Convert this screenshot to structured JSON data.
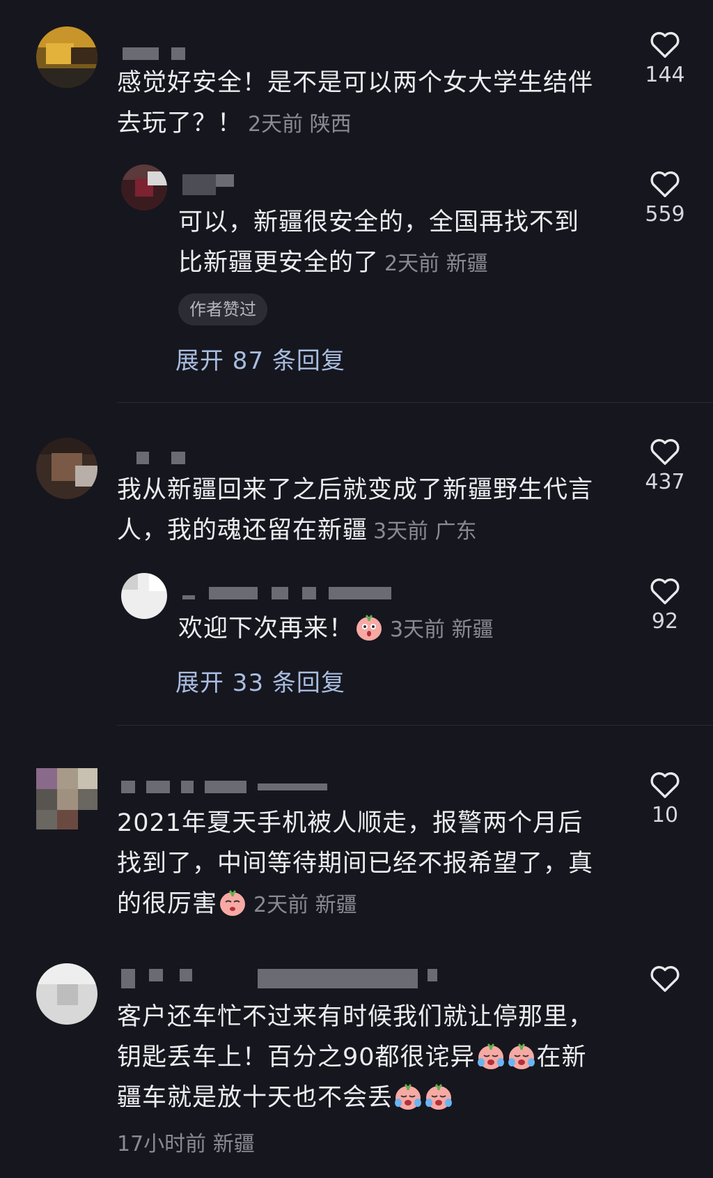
{
  "comments": [
    {
      "text": "感觉好安全！是不是可以两个女大学生结伴去玩了？！",
      "line1": "感觉好安全！是不是可以两个女大学生结伴",
      "line2": "去玩了？！",
      "time": "2天前",
      "location": "陕西",
      "likes": "144",
      "reply": {
        "line1": "可以，新疆很安全的，全国再找不到",
        "line2": "比新疆更安全的了",
        "time": "2天前",
        "location": "新疆",
        "likes": "559",
        "badge": "作者赞过"
      },
      "expand": "展开 87 条回复"
    },
    {
      "line1": "我从新疆回来了之后就变成了新疆野生代言",
      "line2": "人，我的魂还留在新疆",
      "time": "3天前",
      "location": "广东",
      "likes": "437",
      "reply": {
        "line1": "欢迎下次再来！",
        "time": "3天前",
        "location": "新疆",
        "likes": "92"
      },
      "expand": "展开 33 条回复"
    },
    {
      "line1": "2021年夏天手机被人顺走，报警两个月后",
      "line2": "找到了，中间等待期间已经不报希望了，真",
      "line3": "的很厉害",
      "time": "2天前",
      "location": "新疆",
      "likes": "10"
    },
    {
      "line1": "客户还车忙不过来有时候我们就让停那里，",
      "line2a": "钥匙丢车上！百分之90都很诧异",
      "line2b": "在新",
      "line3": "疆车就是放十天也不会丢",
      "time": "17小时前",
      "location": "新疆"
    }
  ],
  "icons": {
    "like": "heart-outline-icon",
    "emoji": "peach-face-emoji-icon"
  },
  "colors": {
    "background": "#16161e",
    "text": "#ececf0",
    "meta": "#8a8a92",
    "link": "#a8bde0"
  }
}
